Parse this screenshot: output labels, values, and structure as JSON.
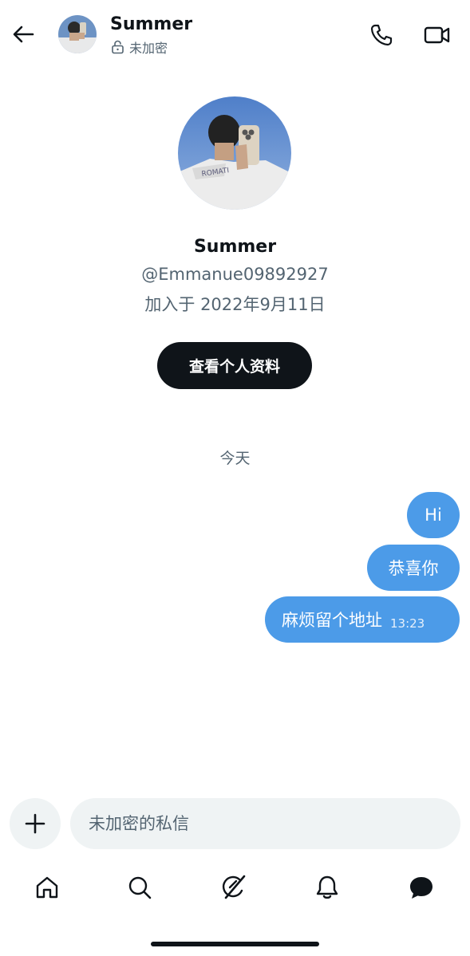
{
  "header": {
    "name": "Summer",
    "encryption_label": "未加密"
  },
  "profile": {
    "name": "Summer",
    "handle": "@Emmanue09892927",
    "joined": "加入于 2022年9月11日",
    "view_profile_label": "查看个人资料"
  },
  "chat": {
    "date_separator": "今天",
    "messages": [
      {
        "text": "Hi",
        "direction": "outgoing"
      },
      {
        "text": "恭喜你",
        "direction": "outgoing"
      },
      {
        "text": "麻烦留个地址",
        "direction": "outgoing",
        "time": "13:23"
      }
    ]
  },
  "composer": {
    "placeholder": "未加密的私信"
  },
  "colors": {
    "bubble": "#4c9be8",
    "button_dark": "#0f1419",
    "secondary_text": "#536471",
    "input_bg": "#eff3f4"
  },
  "icons": {
    "back": "back-arrow-icon",
    "lock": "unlocked-icon",
    "call": "phone-icon",
    "video": "video-camera-icon",
    "plus": "plus-icon",
    "nav": [
      "home-icon",
      "search-icon",
      "grok-icon",
      "bell-icon",
      "messages-icon"
    ]
  }
}
